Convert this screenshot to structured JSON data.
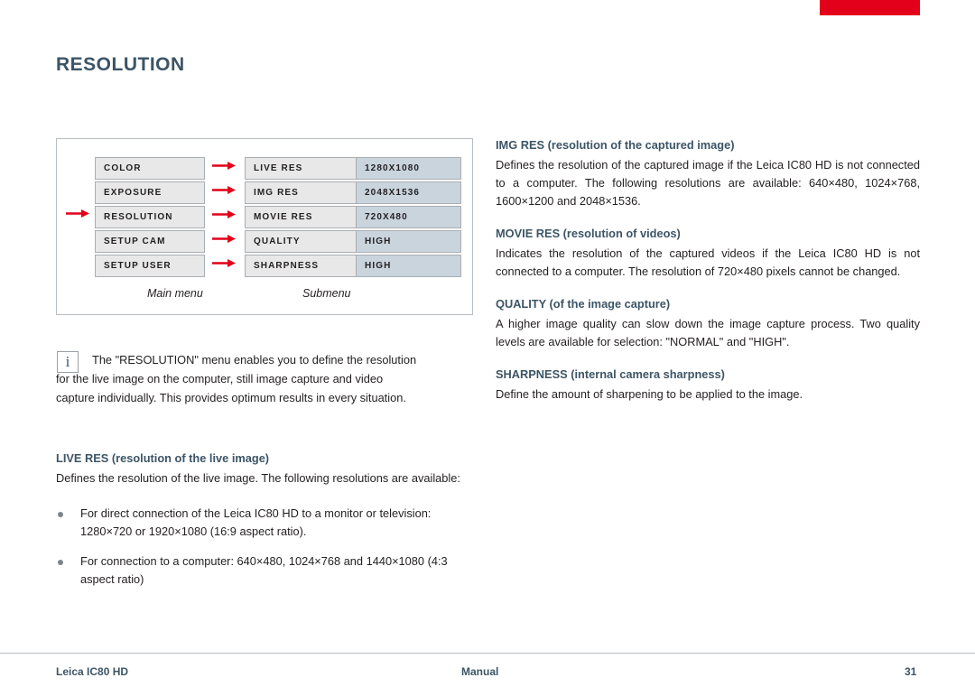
{
  "page": {
    "title": "RESOLUTION",
    "accent_red": "#e2001a",
    "heading_color": "#3c5566"
  },
  "diagram": {
    "main_caption": "Main menu",
    "sub_caption": "Submenu",
    "main_menu": [
      {
        "label": "COLOR"
      },
      {
        "label": "EXPOSURE"
      },
      {
        "label": "RESOLUTION"
      },
      {
        "label": "SETUP CAM"
      },
      {
        "label": "SETUP USER"
      }
    ],
    "submenu": [
      {
        "label": "LIVE RES",
        "value": "1280X1080"
      },
      {
        "label": "IMG RES",
        "value": "2048X1536"
      },
      {
        "label": "MOVIE RES",
        "value": "720X480"
      },
      {
        "label": "QUALITY",
        "value": "HIGH"
      },
      {
        "label": "SHARPNESS",
        "value": "HIGH"
      }
    ]
  },
  "info": {
    "line1": "The \"RESOLUTION\" menu enables you to define the resolution",
    "line2": "for the live image on the computer, still image capture and video",
    "line3": "capture individually. This provides optimum results in every situation.",
    "icon_glyph": "i"
  },
  "left_column": {
    "live_res": {
      "heading": "LIVE RES (resolution of the live image)",
      "body": "Defines the resolution of the live image. The following resolutions are available:",
      "bullets": [
        "For direct connection of the Leica IC80 HD to a monitor or television: 1280×720 or 1920×1080 (16:9 aspect ratio).",
        "For connection to a computer: 640×480, 1024×768 and 1440×1080 (4:3 aspect ratio)"
      ]
    }
  },
  "right_column": {
    "img_res": {
      "heading": "IMG RES (resolution of the captured image)",
      "body": "Defines the resolution of the captured image if the Leica IC80 HD is not connected to a computer. The following resolutions are available: 640×480, 1024×768, 1600×1200 and 2048×1536."
    },
    "movie_res": {
      "heading": "MOVIE RES (resolution of videos)",
      "body": "Indicates the resolution of the captured videos if the Leica IC80 HD is not connected to a computer. The resolution of 720×480 pixels cannot be changed."
    },
    "quality": {
      "heading": "QUALITY (of the image capture)",
      "body": "A higher image quality can slow down the image capture process. Two quality levels are available for selection: \"NORMAL\" and \"HIGH\"."
    },
    "sharpness": {
      "heading": "SHARPNESS (internal camera sharpness)",
      "body": "Define the amount of sharpening to be applied to the image."
    }
  },
  "footer": {
    "left": "Leica IC80 HD",
    "center": "Manual",
    "page_number": "31"
  }
}
